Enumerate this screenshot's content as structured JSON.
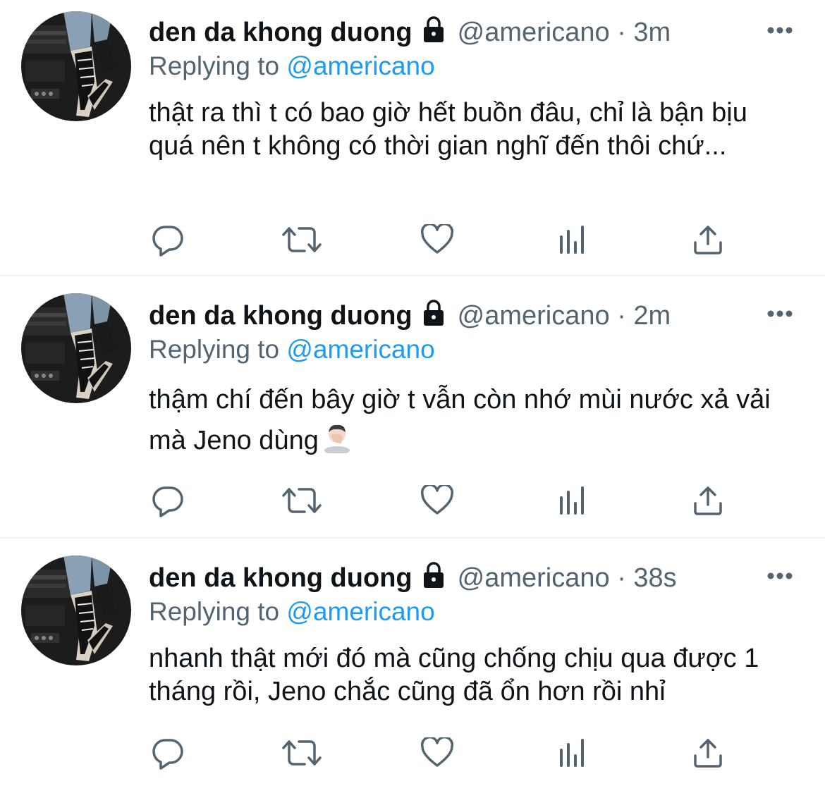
{
  "colors": {
    "text": "#0f1419",
    "secondary": "#536471",
    "link": "#1d9bf0",
    "divider": "#eff3f4"
  },
  "tweets": [
    {
      "display_name": "den da khong duong",
      "handle": "@americano",
      "separator": "·",
      "time": "3m",
      "replying_prefix": "Replying to",
      "replying_to": "@americano",
      "text": "thật ra thì t có bao giờ hết buồn đâu, chỉ là bận bịu quá nên t không có thời gian nghĩ đến thôi chứ...",
      "emoji": ""
    },
    {
      "display_name": "den da khong duong",
      "handle": "@americano",
      "separator": "·",
      "time": "2m",
      "replying_prefix": "Replying to",
      "replying_to": "@americano",
      "text": "thậm chí đến bây giờ t vẫn còn nhớ mùi nước xả vải mà Jeno dùng",
      "emoji": "facepalm-emoji"
    },
    {
      "display_name": "den da khong duong",
      "handle": "@americano",
      "separator": "·",
      "time": "38s",
      "replying_prefix": "Replying to",
      "replying_to": "@americano",
      "text": "nhanh thật mới đó mà cũng chống chịu qua được 1 tháng rồi, Jeno chắc cũng đã ổn hơn rồi nhỉ",
      "emoji": ""
    }
  ],
  "icons": {
    "lock": "lock-icon",
    "more": "more-options-icon",
    "reply": "reply-icon",
    "retweet": "retweet-icon",
    "like": "like-icon",
    "analytics": "analytics-icon",
    "share": "share-icon"
  }
}
